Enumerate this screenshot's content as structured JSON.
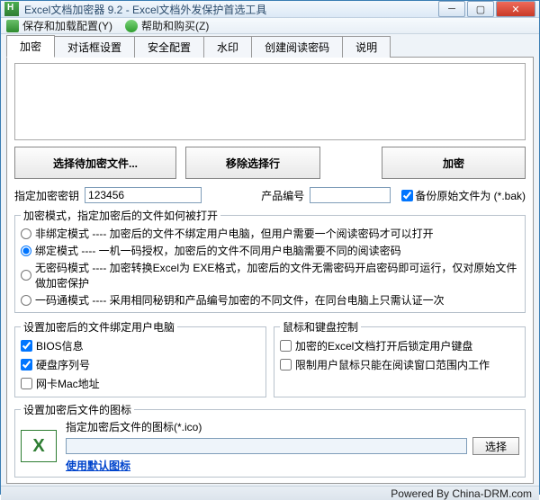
{
  "window": {
    "title": "Excel文档加密器 9.2 - Excel文档外发保护首选工具"
  },
  "menu": {
    "save_config": "保存和加载配置(Y)",
    "help_buy": "帮助和购买(Z)"
  },
  "tabs": {
    "encrypt": "加密",
    "dialog": "对话框设置",
    "security": "安全配置",
    "watermark": "水印",
    "create_pwd": "创建阅读密码",
    "explain": "说明"
  },
  "buttons": {
    "select_files": "选择待加密文件...",
    "remove_row": "移除选择行",
    "encrypt": "加密",
    "browse": "选择"
  },
  "key": {
    "label": "指定加密密钥",
    "value": "123456",
    "product_no_label": "产品编号",
    "product_no_value": "",
    "backup_label": "备份原始文件为 (*.bak)"
  },
  "modes": {
    "legend": "加密模式，指定加密后的文件如何被打开",
    "m1": "非绑定模式 ---- 加密后的文件不绑定用户电脑，但用户需要一个阅读密码才可以打开",
    "m2": "绑定模式 ---- 一机一码授权，加密后的文件不同用户电脑需要不同的阅读密码",
    "m3": "无密码模式 ---- 加密转换Excel为 EXE格式，加密后的文件无需密码开启密码即可运行，仅对原始文件做加密保护",
    "m4": "一码通模式 ---- 采用相同秘钥和产品编号加密的不同文件，在同台电脑上只需认证一次"
  },
  "bind": {
    "legend": "设置加密后的文件绑定用户电脑",
    "bios": "BIOS信息",
    "hdd": "硬盘序列号",
    "mac": "网卡Mac地址"
  },
  "mouse": {
    "legend": "鼠标和键盘控制",
    "opt1": "加密的Excel文档打开后锁定用户键盘",
    "opt2": "限制用户鼠标只能在阅读窗口范围内工作"
  },
  "icon": {
    "legend": "设置加密后文件的图标",
    "hint": "指定加密后文件的图标(*.ico)",
    "path": "",
    "use_default": "使用默认图标"
  },
  "footer": "Powered By China-DRM.com"
}
